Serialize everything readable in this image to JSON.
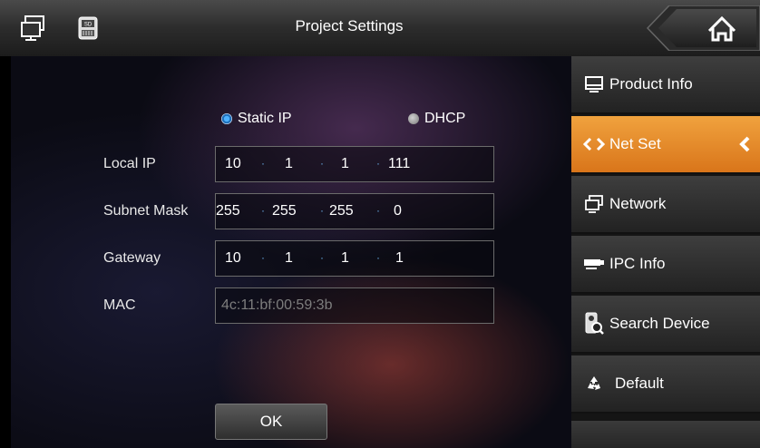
{
  "header": {
    "title": "Project Settings",
    "left_icons": [
      "network-computer-icon",
      "sd-card-icon"
    ],
    "home_icon": "home-icon"
  },
  "net": {
    "mode_static_label": "Static IP",
    "mode_dhcp_label": "DHCP",
    "selected_mode": "Static IP",
    "local_ip": {
      "label": "Local IP",
      "octets": [
        "10",
        "1",
        "1",
        "111"
      ]
    },
    "subnet_mask": {
      "label": "Subnet Mask",
      "octets": [
        "255",
        "255",
        "255",
        "0"
      ]
    },
    "gateway": {
      "label": "Gateway",
      "octets": [
        "10",
        "1",
        "1",
        "1"
      ]
    },
    "mac": {
      "label": "MAC",
      "value": "4c:11:bf:00:59:3b"
    },
    "ok_label": "OK"
  },
  "sidebar": {
    "items": [
      {
        "label": "Product Info",
        "icon": "monitor-icon"
      },
      {
        "label": "Net Set",
        "icon": "code-brackets-icon",
        "active": true
      },
      {
        "label": "Network",
        "icon": "network-computer-icon"
      },
      {
        "label": "IPC Info",
        "icon": "camera-icon"
      },
      {
        "label": "Search Device",
        "icon": "search-device-icon"
      },
      {
        "label": "Default",
        "icon": "recycle-icon"
      }
    ]
  },
  "colors": {
    "accent": "#e88a2a",
    "radio_selected": "#3a9ae8",
    "text": "#ffffff"
  }
}
